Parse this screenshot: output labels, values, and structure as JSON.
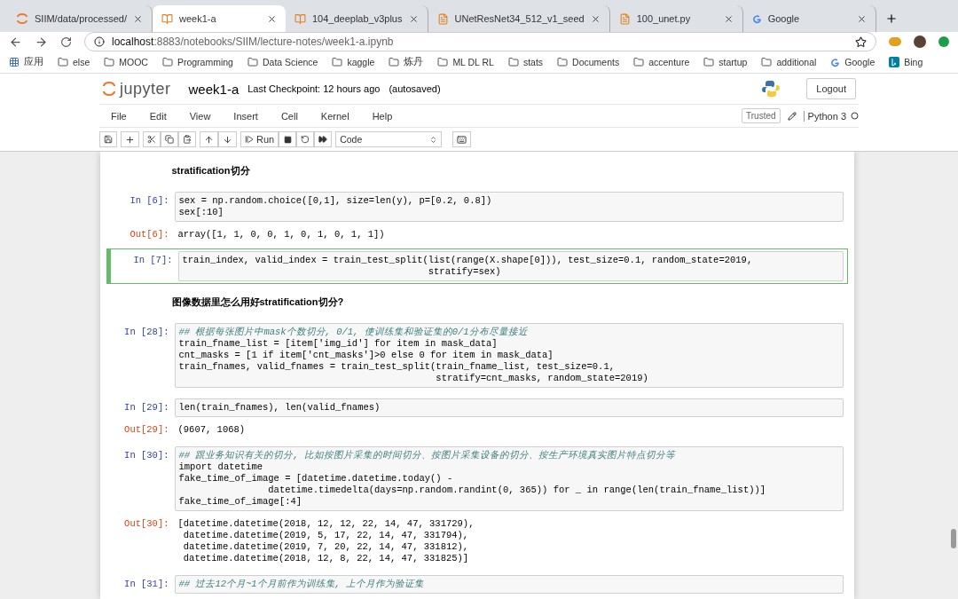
{
  "tabs": [
    {
      "title": "SIIM/data/processed/",
      "kind": "jupyter",
      "selected": false
    },
    {
      "title": "week1-a",
      "kind": "notebook",
      "selected": true
    },
    {
      "title": "104_deeplab_v3plus",
      "kind": "notebook",
      "selected": false
    },
    {
      "title": "UNetResNet34_512_v1_seed",
      "kind": "file",
      "selected": false
    },
    {
      "title": "100_unet.py",
      "kind": "file",
      "selected": false
    },
    {
      "title": "Google",
      "kind": "google",
      "selected": false
    }
  ],
  "address": {
    "host": "localhost",
    "rest": ":8883/notebooks/SIIM/lecture-notes/week1-a.ipynb"
  },
  "bookmarks": [
    {
      "label": "应用",
      "kind": "apps"
    },
    {
      "label": "else",
      "kind": "folder"
    },
    {
      "label": "MOOC",
      "kind": "folder"
    },
    {
      "label": "Programming",
      "kind": "folder"
    },
    {
      "label": "Data Science",
      "kind": "folder"
    },
    {
      "label": "kaggle",
      "kind": "folder"
    },
    {
      "label": "炼丹",
      "kind": "folder"
    },
    {
      "label": "ML DL RL",
      "kind": "folder"
    },
    {
      "label": "stats",
      "kind": "folder"
    },
    {
      "label": "Documents",
      "kind": "folder"
    },
    {
      "label": "accenture",
      "kind": "folder"
    },
    {
      "label": "startup",
      "kind": "folder"
    },
    {
      "label": "additional",
      "kind": "folder"
    },
    {
      "label": "Google",
      "kind": "google"
    },
    {
      "label": "Bing",
      "kind": "bing"
    }
  ],
  "header": {
    "logo": "jupyter",
    "notebook": "week1-a",
    "checkpoint": "Last Checkpoint: 12 hours ago",
    "saved": "(autosaved)",
    "logout": "Logout"
  },
  "menu": [
    "File",
    "Edit",
    "View",
    "Insert",
    "Cell",
    "Kernel",
    "Help"
  ],
  "kernel": {
    "trusted": "Trusted",
    "name": "Python 3"
  },
  "toolbar": {
    "run": "Run",
    "cell_type": "Code"
  },
  "cells": [
    {
      "kind": "markdown",
      "text": "stratification切分"
    },
    {
      "kind": "code",
      "prompt": "In [6]:",
      "selected": false,
      "lines": [
        {
          "kind": "code",
          "text": "sex = np.random.choice([0,1], size=len(y), p=[0.2, 0.8])"
        },
        {
          "kind": "code",
          "text": "sex[:10]"
        }
      ],
      "out_prompt": "Out[6]:",
      "output": [
        "array([1, 1, 0, 0, 1, 0, 1, 0, 1, 1])"
      ]
    },
    {
      "kind": "code",
      "prompt": "In [7]:",
      "selected": true,
      "lines": [
        {
          "kind": "code",
          "text": "train_index, valid_index = train_test_split(list(range(X.shape[0])), test_size=0.1, random_state=2019,"
        },
        {
          "kind": "code",
          "text": "                                            stratify=sex)"
        }
      ]
    },
    {
      "kind": "markdown",
      "text": "图像数据里怎么用好stratification切分?"
    },
    {
      "kind": "code",
      "prompt": "In [28]:",
      "selected": false,
      "lines": [
        {
          "kind": "comment",
          "text": "## 根据每张图片中mask个数切分, 0/1, 使训练集和验证集的0/1分布尽量接近"
        },
        {
          "kind": "code",
          "text": "train_fname_list = [item['img_id'] for item in mask_data]"
        },
        {
          "kind": "code",
          "text": "cnt_masks = [1 if item['cnt_masks']>0 else 0 for item in mask_data]"
        },
        {
          "kind": "code",
          "text": "train_fnames, valid_fnames = train_test_split(train_fname_list, test_size=0.1,"
        },
        {
          "kind": "code",
          "text": "                                              stratify=cnt_masks, random_state=2019)"
        }
      ]
    },
    {
      "kind": "code",
      "prompt": "In [29]:",
      "selected": false,
      "lines": [
        {
          "kind": "code",
          "text": "len(train_fnames), len(valid_fnames)"
        }
      ],
      "out_prompt": "Out[29]:",
      "output": [
        "(9607, 1068)"
      ]
    },
    {
      "kind": "code",
      "prompt": "In [30]:",
      "selected": false,
      "lines": [
        {
          "kind": "comment",
          "text": "## 跟业务知识有关的切分, 比如按图片采集的时间切分、按图片采集设备的切分、按生产环境真实图片特点切分等"
        },
        {
          "kind": "code",
          "text": "import datetime"
        },
        {
          "kind": "code",
          "text": "fake_time_of_image = [datetime.datetime.today() -"
        },
        {
          "kind": "code",
          "text": "                datetime.timedelta(days=np.random.randint(0, 365)) for _ in range(len(train_fname_list))]"
        },
        {
          "kind": "code",
          "text": "fake_time_of_image[:4]"
        }
      ],
      "out_prompt": "Out[30]:",
      "output": [
        "[datetime.datetime(2018, 12, 12, 22, 14, 47, 331729),",
        " datetime.datetime(2019, 5, 17, 22, 14, 47, 331794),",
        " datetime.datetime(2019, 7, 20, 22, 14, 47, 331812),",
        " datetime.datetime(2018, 12, 8, 22, 14, 47, 331825)]"
      ]
    },
    {
      "kind": "code",
      "prompt": "In [31]:",
      "selected": false,
      "lines": [
        {
          "kind": "comment",
          "text": "## 过去12个月~1个月前作为训练集, 上个月作为验证集"
        }
      ]
    }
  ]
}
